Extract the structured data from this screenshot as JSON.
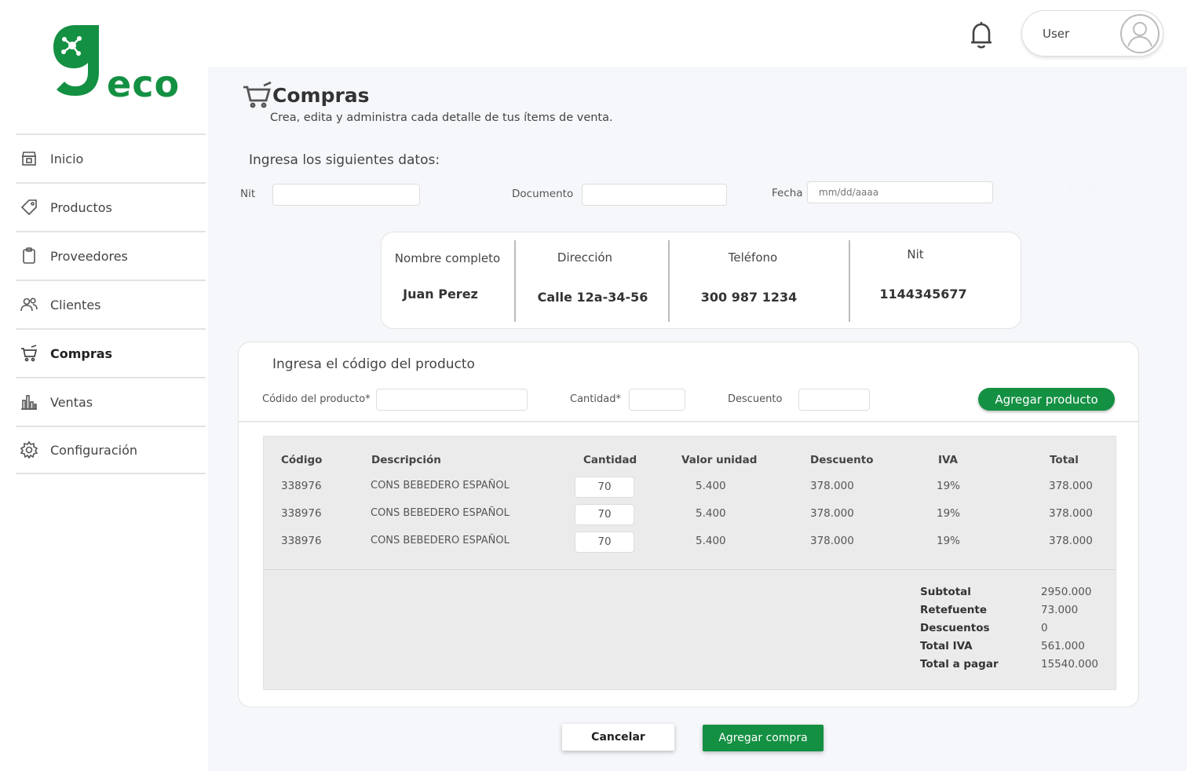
{
  "brand": {
    "name": "eco",
    "color": "#149043"
  },
  "sidebar": {
    "items": [
      {
        "label": "Inicio",
        "icon": "store-icon"
      },
      {
        "label": "Productos",
        "icon": "tag-icon"
      },
      {
        "label": "Proveedores",
        "icon": "clipboard-icon"
      },
      {
        "label": "Clientes",
        "icon": "users-icon"
      },
      {
        "label": "Compras",
        "icon": "cart-icon",
        "active": true
      },
      {
        "label": "Ventas",
        "icon": "bar-chart-icon"
      },
      {
        "label": "Configuración",
        "icon": "gear-icon"
      }
    ]
  },
  "header": {
    "user_label": "User",
    "notification_icon": "bell-icon",
    "avatar_icon": "user-avatar-icon"
  },
  "page": {
    "title": "Compras",
    "subtitle": "Crea, edita y administra cada detalle de tus ítems de venta."
  },
  "form": {
    "section_label": "Ingresa los siguientes datos:",
    "nit_label": "Nit",
    "documento_label": "Documento",
    "fecha_label": "Fecha",
    "fecha_placeholder": "mm/dd/aaaa",
    "ghost_label": "Aceptar"
  },
  "client": {
    "headers": [
      "Nombre completo",
      "Dirección",
      "Teléfono",
      "Nit"
    ],
    "values": [
      "Juan Perez",
      "Calle 12a-34-56",
      "300 987 1234",
      "1144345677"
    ]
  },
  "product_form": {
    "section_label": "Ingresa el código del producto",
    "code_label": "Códido del producto*",
    "qty_label": "Cantidad*",
    "discount_label": "Descuento",
    "add_button": "Agregar producto"
  },
  "table": {
    "headers": [
      "Código",
      "Descripción",
      "Cantidad",
      "Valor unidad",
      "Descuento",
      "IVA",
      "Total"
    ],
    "rows": [
      [
        "338976",
        "CONS BEBEDERO ESPAÑOL",
        "70",
        "5.400",
        "378.000",
        "19%",
        "378.000"
      ],
      [
        "338976",
        "CONS BEBEDERO ESPAÑOL",
        "70",
        "5.400",
        "378.000",
        "19%",
        "378.000"
      ],
      [
        "338976",
        "CONS BEBEDERO ESPAÑOL",
        "70",
        "5.400",
        "378.000",
        "19%",
        "378.000"
      ]
    ]
  },
  "summary": [
    {
      "label": "Subtotal",
      "value": "2950.000"
    },
    {
      "label": "Retefuente",
      "value": "73.000"
    },
    {
      "label": "Descuentos",
      "value": "0"
    },
    {
      "label": "Total IVA",
      "value": "561.000"
    },
    {
      "label": "Total a pagar",
      "value": "15540.000"
    }
  ],
  "actions": {
    "cancel": "Cancelar",
    "submit": "Agregar compra"
  }
}
